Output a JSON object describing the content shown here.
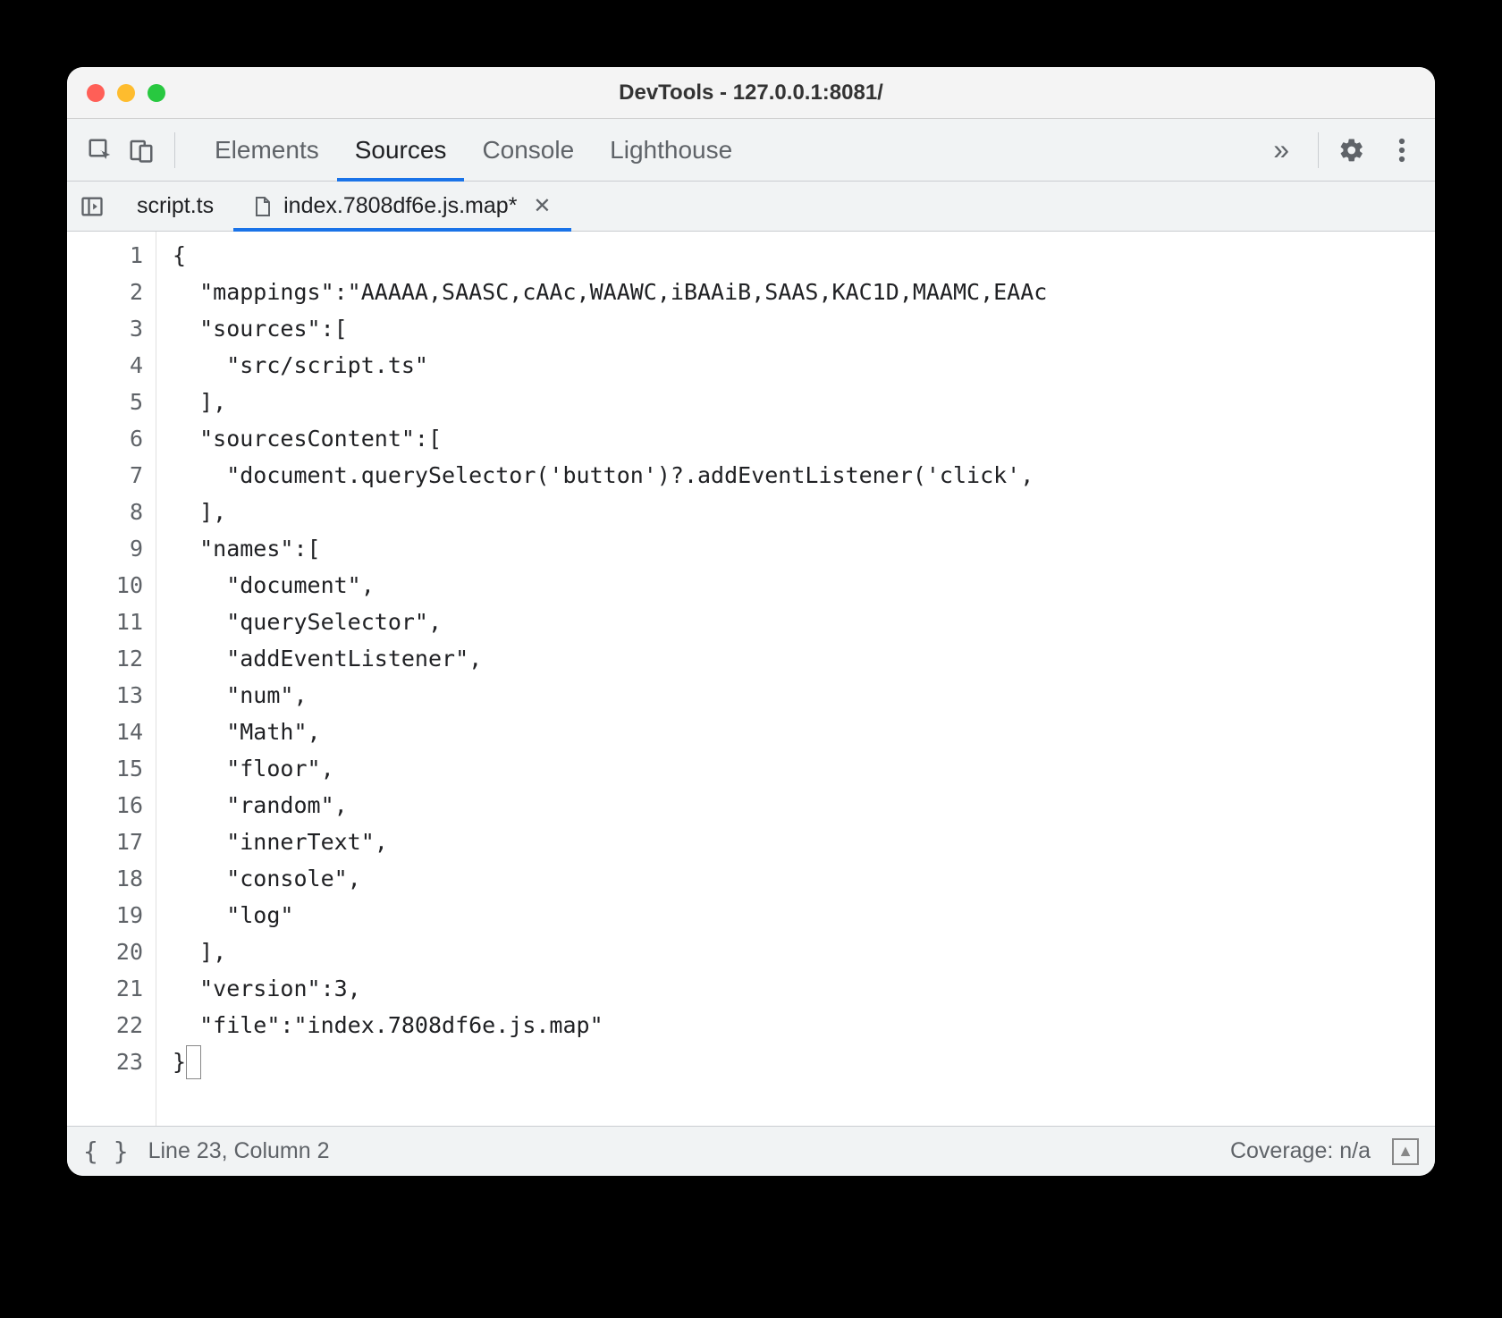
{
  "window": {
    "title": "DevTools - 127.0.0.1:8081/"
  },
  "mainTabs": {
    "items": [
      {
        "label": "Elements",
        "active": false
      },
      {
        "label": "Sources",
        "active": true
      },
      {
        "label": "Console",
        "active": false
      },
      {
        "label": "Lighthouse",
        "active": false
      }
    ],
    "overflow": "»"
  },
  "fileTabs": {
    "items": [
      {
        "label": "script.ts",
        "active": false,
        "modified": false,
        "icon": "none"
      },
      {
        "label": "index.7808df6e.js.map*",
        "active": true,
        "modified": true,
        "icon": "document"
      }
    ]
  },
  "editor": {
    "lines": [
      "{",
      "  \"mappings\":\"AAAAA,SAASC,cAAc,WAAWC,iBAAiB,SAAS,KAC1D,MAAMC,EAAc",
      "  \"sources\":[",
      "    \"src/script.ts\"",
      "  ],",
      "  \"sourcesContent\":[",
      "    \"document.querySelector('button')?.addEventListener('click',",
      "  ],",
      "  \"names\":[",
      "    \"document\",",
      "    \"querySelector\",",
      "    \"addEventListener\",",
      "    \"num\",",
      "    \"Math\",",
      "    \"floor\",",
      "    \"random\",",
      "    \"innerText\",",
      "    \"console\",",
      "    \"log\"",
      "  ],",
      "  \"version\":3,",
      "  \"file\":\"index.7808df6e.js.map\"",
      "}"
    ],
    "cursorLine": 23,
    "cursorCol": 2
  },
  "statusbar": {
    "position": "Line 23, Column 2",
    "coverage": "Coverage: n/a"
  }
}
